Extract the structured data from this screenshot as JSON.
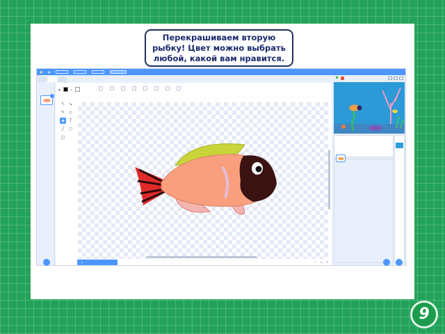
{
  "slide": {
    "caption": "Перекрашиваем вторую рыбку! Цвет можно выбрать любой, какой вам нравится.",
    "page_number": "9"
  },
  "editor": {
    "colors": {
      "menubar": "#4c97ff",
      "fish_body": "#f99f7e",
      "fish_fin_top": "#c8d43a",
      "fish_head": "#3a1212",
      "fish_tail": "#e02a2a"
    },
    "icons": [
      "scratch-logo-icon",
      "green-flag-icon",
      "stop-icon",
      "add-costume-icon",
      "add-sprite-icon",
      "add-backdrop-icon"
    ]
  }
}
